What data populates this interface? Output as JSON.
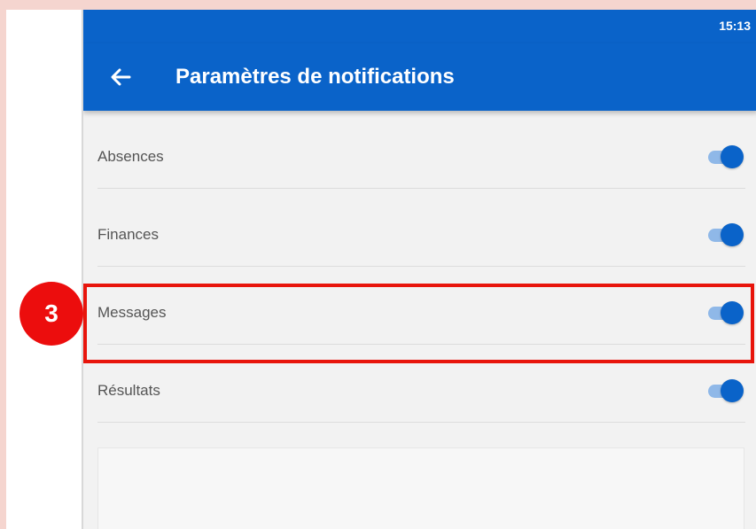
{
  "status_bar": {
    "time": "15:13"
  },
  "app_bar": {
    "title": "Paramètres de notifications",
    "back_icon": "arrow-left-icon"
  },
  "settings": [
    {
      "label": "Absences",
      "enabled": true
    },
    {
      "label": "Finances",
      "enabled": true
    },
    {
      "label": "Messages",
      "enabled": true
    },
    {
      "label": "Résultats",
      "enabled": true
    }
  ],
  "annotation": {
    "step_number": "3",
    "highlighted_item": "Messages"
  },
  "colors": {
    "primary": "#0a63c9",
    "toggle_track": "#8fb8e8",
    "highlight": "#e8150c",
    "page_background": "#f5d5cf"
  }
}
